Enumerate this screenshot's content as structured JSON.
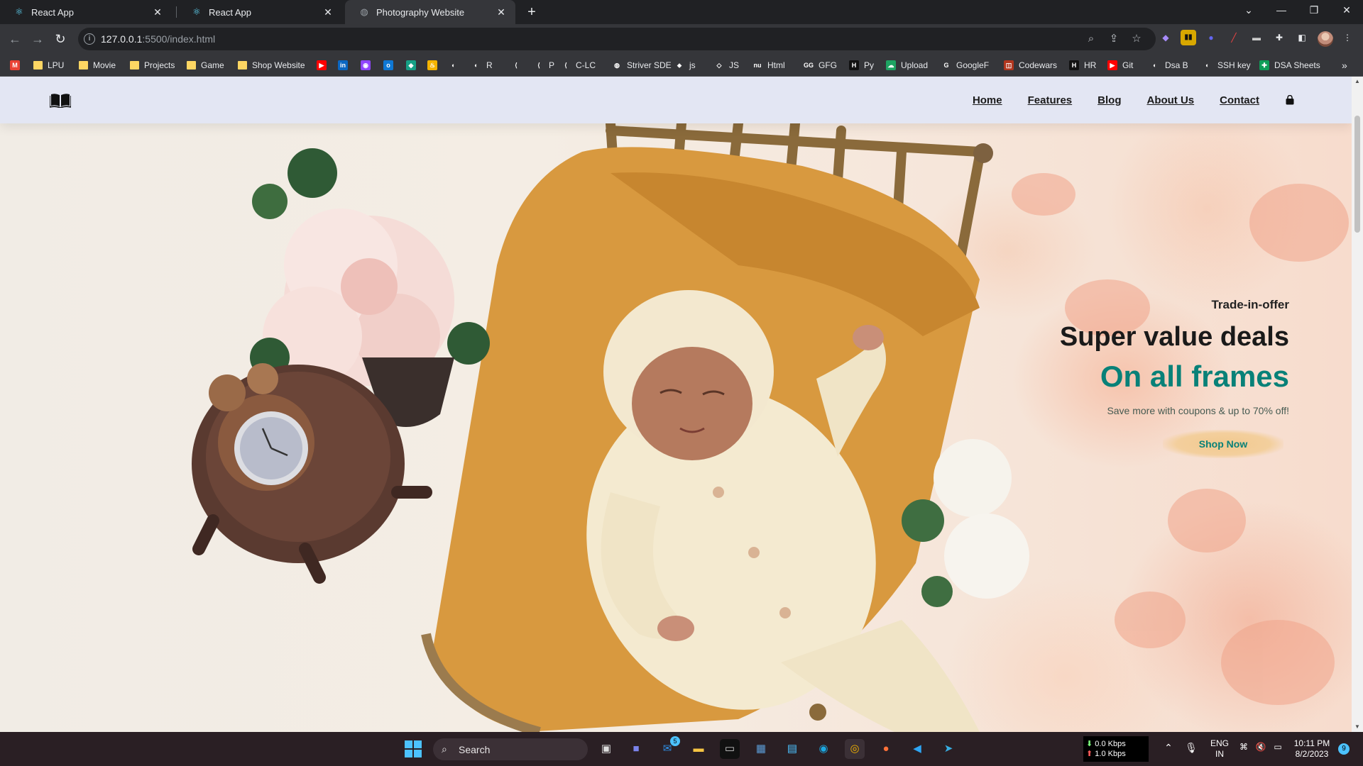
{
  "browser": {
    "tabs": [
      {
        "title": "React App",
        "icon": "react-icon"
      },
      {
        "title": "React App",
        "icon": "react-icon"
      },
      {
        "title": "Photography Website",
        "icon": "globe-icon",
        "active": true
      }
    ],
    "url_host": "127.0.0.1",
    "url_path": ":5500/index.html",
    "bookmarks": [
      {
        "label": "",
        "icon": "gmail-icon"
      },
      {
        "label": "LPU",
        "icon": "folder-icon"
      },
      {
        "label": "Movie",
        "icon": "folder-icon"
      },
      {
        "label": "Projects",
        "icon": "folder-icon"
      },
      {
        "label": "Game",
        "icon": "folder-icon"
      },
      {
        "label": "Shop Website",
        "icon": "folder-icon"
      },
      {
        "label": "",
        "icon": "youtube-icon"
      },
      {
        "label": "",
        "icon": "linkedin-icon"
      },
      {
        "label": "",
        "icon": "extension-icon"
      },
      {
        "label": "",
        "icon": "outlook-icon"
      },
      {
        "label": "",
        "icon": "diamond-icon"
      },
      {
        "label": "",
        "icon": "flame-icon"
      },
      {
        "label": "",
        "icon": "github-icon"
      },
      {
        "label": "R",
        "icon": "github-icon"
      },
      {
        "label": "",
        "icon": "leetcode-icon"
      },
      {
        "label": "P",
        "icon": "leetcode-icon"
      },
      {
        "label": "C-LC",
        "icon": "leetcode-icon"
      },
      {
        "label": "Striver SDE",
        "icon": "globe-icon"
      },
      {
        "label": "js",
        "icon": "git-icon"
      },
      {
        "label": "JS",
        "icon": "code-icon"
      },
      {
        "label": "Html",
        "icon": "nu-icon"
      },
      {
        "label": "GFG",
        "icon": "gfg-icon"
      },
      {
        "label": "Py",
        "icon": "hackerrank-icon"
      },
      {
        "label": "Upload",
        "icon": "cloud-icon"
      },
      {
        "label": "GoogleF",
        "icon": "google-icon"
      },
      {
        "label": "Codewars",
        "icon": "codewars-icon"
      },
      {
        "label": "HR",
        "icon": "hackerrank-icon"
      },
      {
        "label": "Git",
        "icon": "youtube-icon"
      },
      {
        "label": "Dsa B",
        "icon": "github-icon"
      },
      {
        "label": "SSH key",
        "icon": "github-icon"
      },
      {
        "label": "DSA Sheets",
        "icon": "plus-icon"
      }
    ]
  },
  "site": {
    "nav": [
      "Home",
      "Features",
      "Blog",
      "About Us",
      "Contact"
    ],
    "hero": {
      "kicker": "Trade-in-offer",
      "heading": "Super value deals",
      "subheading": "On all frames",
      "description": "Save more with coupons & up to 70% off!",
      "cta": "Shop Now"
    },
    "colors": {
      "accent": "#088178",
      "header_bg": "#e3e6f3",
      "button_bg": "#f3cf9d"
    }
  },
  "taskbar": {
    "search_placeholder": "Search",
    "mail_badge": "5",
    "net_down": "0.0 Kbps",
    "net_up": "1.0 Kbps",
    "lang": "ENG",
    "region": "IN",
    "time": "10:11 PM",
    "date": "8/2/2023",
    "notification_count": "9"
  }
}
